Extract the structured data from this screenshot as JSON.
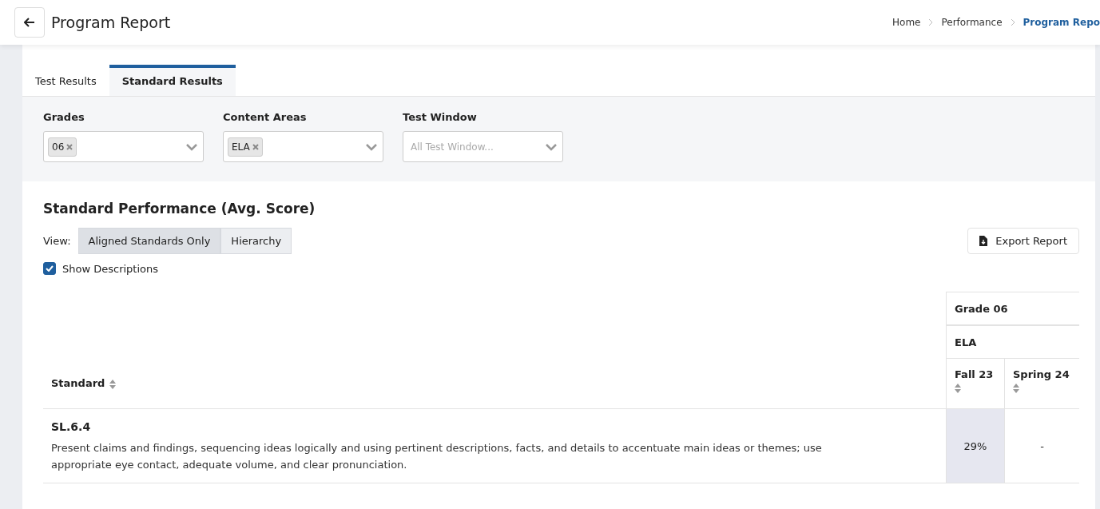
{
  "header": {
    "title": "Program Report",
    "breadcrumbs": [
      {
        "label": "Home",
        "current": false
      },
      {
        "label": "Performance",
        "current": false
      },
      {
        "label": "Program Repo",
        "current": true
      }
    ]
  },
  "tabs": [
    {
      "label": "Test Results",
      "selected": false
    },
    {
      "label": "Standard Results",
      "selected": true
    }
  ],
  "filters": [
    {
      "label": "Grades",
      "tags": [
        "06"
      ]
    },
    {
      "label": "Content Areas",
      "tags": [
        "ELA"
      ]
    },
    {
      "label": "Test Window",
      "placeholder": "All Test Window..."
    }
  ],
  "section": {
    "title": "Standard Performance (Avg. Score)",
    "view_label": "View:",
    "views": [
      {
        "label": "Aligned Standards Only",
        "selected": true
      },
      {
        "label": "Hierarchy",
        "selected": false
      }
    ],
    "export": "Export Report",
    "show_descriptions": {
      "label": "Show Descriptions",
      "checked": true
    }
  },
  "table": {
    "standard_header": "Standard",
    "grade": "Grade 06",
    "content_area": "ELA",
    "columns": [
      "Fall 23",
      "Spring 24"
    ],
    "rows": [
      {
        "code": "SL.6.4",
        "description": "Present claims and findings, sequencing ideas logically and using pertinent descriptions, facts, and details to accentuate main ideas or themes; use appropriate eye contact, adequate volume, and clear pronunciation.",
        "values": [
          {
            "text": "29%",
            "shaded": true
          },
          {
            "text": "-",
            "shaded": false
          }
        ]
      }
    ]
  }
}
